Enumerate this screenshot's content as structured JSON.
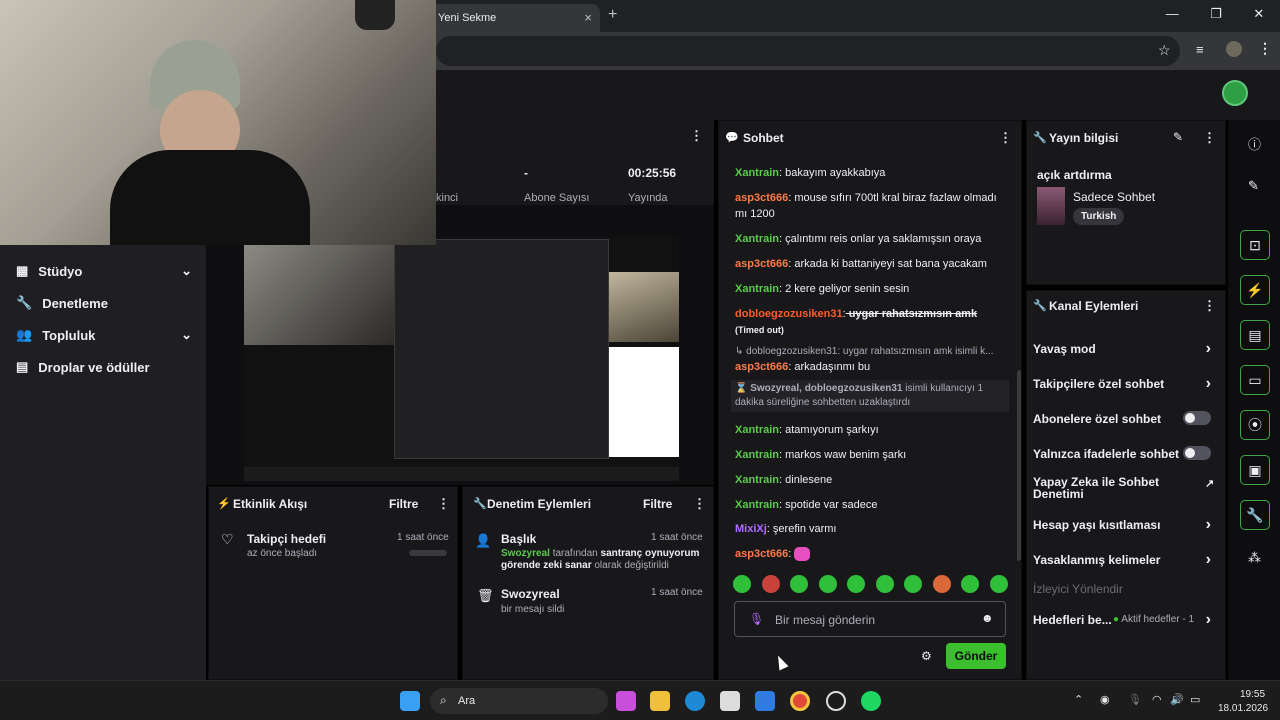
{
  "browser": {
    "tab_title": "Yeni Sekme",
    "tab_close": "×",
    "new_tab": "+",
    "win_min": "—",
    "win_max": "❐",
    "win_close": "✕"
  },
  "stats": {
    "subs_value": "-",
    "subs_label": "Abone Sayısı",
    "partial_label": "kinci",
    "uptime_value": "00:25:56",
    "uptime_label": "Yayında"
  },
  "nav": {
    "items": [
      {
        "label": "Stüdyo"
      },
      {
        "label": "Denetleme"
      },
      {
        "label": "Topluluk"
      },
      {
        "label": "Droplar ve ödüller"
      }
    ]
  },
  "activity": {
    "title": "Etkinlik Akışı",
    "filter": "Filtre",
    "item_title": "Takipçi hedefi",
    "item_sub": "az önce başladı",
    "item_time": "1 saat önce"
  },
  "mod": {
    "title": "Denetim Eylemleri",
    "filter": "Filtre",
    "a1_title": "Başlık",
    "a1_time": "1 saat önce",
    "a1_user": "Swozyreal",
    "a1_by": " tarafından ",
    "a1_value": "santranç oynuyorum görende zeki sanar",
    "a1_tail": " olarak değiştirildi",
    "a2_title": "Swozyreal",
    "a2_time": "1 saat önce",
    "a2_sub": "bir mesajı sildi"
  },
  "chat": {
    "title": "Sohbet",
    "messages": [
      {
        "user": "Xantrain",
        "text": " bakayım ayakkabıya"
      },
      {
        "user": "asp3ct666",
        "text": " mouse sıfırı 700tl kral biraz fazlaw olmadı mı 1200"
      },
      {
        "user": "Xantrain",
        "text": " çalıntımı reis onlar ya saklamışsın oraya"
      },
      {
        "user": "asp3ct666",
        "text": " arkada ki battaniyeyi sat bana yacakam"
      },
      {
        "user": "Xantrain",
        "text": " 2 kere geliyor senin sesin"
      },
      {
        "user": "dobloegzozusiken31",
        "text": " uygar rahatsızmısın amk",
        "tag": " (Timed out)"
      },
      {
        "reply": "↳ dobloegzozusiken31: uygar rahatsızmısın amk isimli k..."
      },
      {
        "user": "asp3ct666",
        "text": " arkadaşınmı bu"
      },
      {
        "notice": "Swozyreal, dobloegzozusiken31",
        "notice_tail": " isimli kullanıcıyı 1 dakika süreliğine sohbetten uzaklaştırdı"
      },
      {
        "user": "Xantrain",
        "text": " atamıyorum şarkıyı"
      },
      {
        "user": "Xantrain",
        "text": " markos waw benim şarkı"
      },
      {
        "user": "Xantrain",
        "text": " dinlesene"
      },
      {
        "user": "Xantrain",
        "text": " spotide var sadece"
      },
      {
        "user": "MixiXj",
        "text": " şerefin varmı"
      },
      {
        "user": "asp3ct666",
        "text": ""
      }
    ],
    "placeholder": "Bir mesaj gönderin",
    "send": "Gönder"
  },
  "info": {
    "title": "Yayın bilgisi",
    "stream_title": "açık artdırma",
    "category": "Sadece Sohbet",
    "tag": "Turkish"
  },
  "channel": {
    "title": "Kanal Eylemleri",
    "items": [
      {
        "label": "Yavaş mod"
      },
      {
        "label": "Takipçilere özel sohbet"
      },
      {
        "label": "Abonelere özel sohbet"
      },
      {
        "label": "Yalnızca ifadelerle sohbet"
      },
      {
        "label": "Yapay Zeka ile Sohbet Denetimi"
      },
      {
        "label": "Hesap yaşı kısıtlaması"
      },
      {
        "label": "Yasaklanmış kelimeler"
      },
      {
        "label": "İzleyici Yönlendir"
      },
      {
        "label": "Hedefleri be..."
      }
    ],
    "goals_sub": "Aktif hedefler - 1"
  },
  "taskbar": {
    "search": "Ara",
    "time": "19:55",
    "date": "18.01.2026"
  },
  "colors": {
    "accent": "#3bbf2e",
    "chat_green": "#5dca4e",
    "chat_orange": "#ff7a45",
    "panel": "#18181b"
  }
}
